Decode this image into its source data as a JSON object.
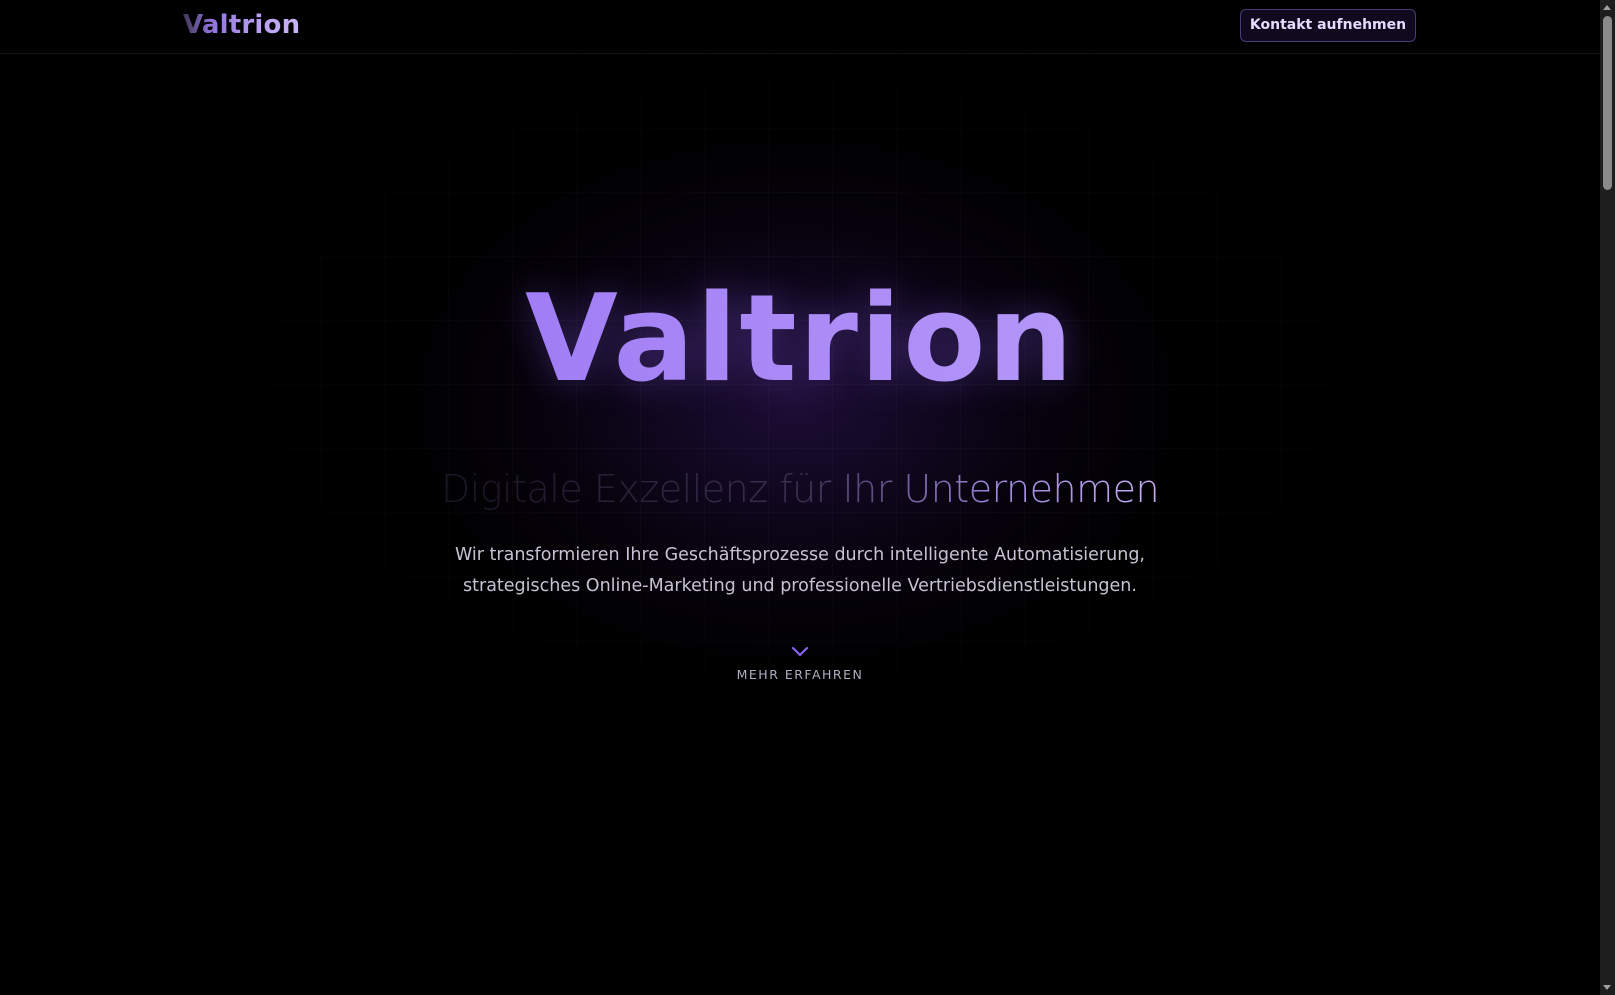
{
  "header": {
    "logo": "Valtrion",
    "contact_button": "Kontakt aufnehmen"
  },
  "hero": {
    "title": "Valtrion",
    "subtitle": "Digitale Exzellenz für Ihr Unternehmen",
    "description_line1": "Wir transformieren Ihre Geschäftsprozesse durch intelligente Automatisierung,",
    "description_line2": "strategisches Online-Marketing und professionelle Vertriebsdienstleistungen.",
    "more_label": "MEHR ERFAHREN",
    "more_icon": "chevron-down-icon"
  },
  "colors": {
    "background": "#000000",
    "accent": "#8c62f5",
    "accent_light": "#c7aefc",
    "button_border": "#4a3a7a",
    "text_muted": "#c7c2d3"
  }
}
